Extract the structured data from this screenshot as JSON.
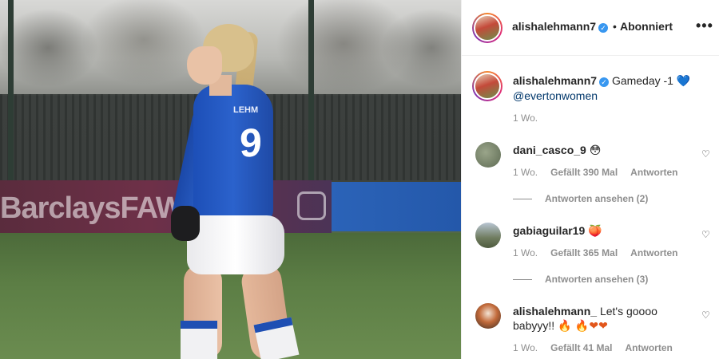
{
  "photo": {
    "board_text": "BarclaysFAW",
    "jersey_name": "LEHM",
    "jersey_number": "9"
  },
  "header": {
    "username": "alishalehmann7",
    "separator": "•",
    "follow_status": "Abonniert",
    "more_icon": "•••"
  },
  "caption": {
    "username": "alishalehmann7",
    "text": "Gameday -1",
    "emoji": "💙",
    "mention": "@evertonwomen",
    "time": "1 Wo."
  },
  "comments": [
    {
      "username": "dani_casco_9",
      "text": "",
      "emoji": "😳",
      "time": "1 Wo.",
      "likes": "Gefällt 390 Mal",
      "reply": "Antworten",
      "view_replies": "Antworten ansehen (2)"
    },
    {
      "username": "gabiaguilar19",
      "text": "",
      "emoji": "🍑",
      "time": "1 Wo.",
      "likes": "Gefällt 365 Mal",
      "reply": "Antworten",
      "view_replies": "Antworten ansehen (3)"
    },
    {
      "username": "alishalehmann_",
      "text": "Let's goooo babyyy!! ",
      "emoji": "🔥 🔥❤❤",
      "time": "1 Wo.",
      "likes": "Gefällt 41 Mal",
      "reply": "Antworten",
      "view_replies": ""
    }
  ],
  "icons": {
    "verified": "verified-badge-icon",
    "heart": "heart-outline-icon",
    "more": "more-options-icon"
  },
  "colors": {
    "verified": "#3897f0",
    "mention": "#00376b",
    "secondary_text": "#8e8e8e"
  }
}
